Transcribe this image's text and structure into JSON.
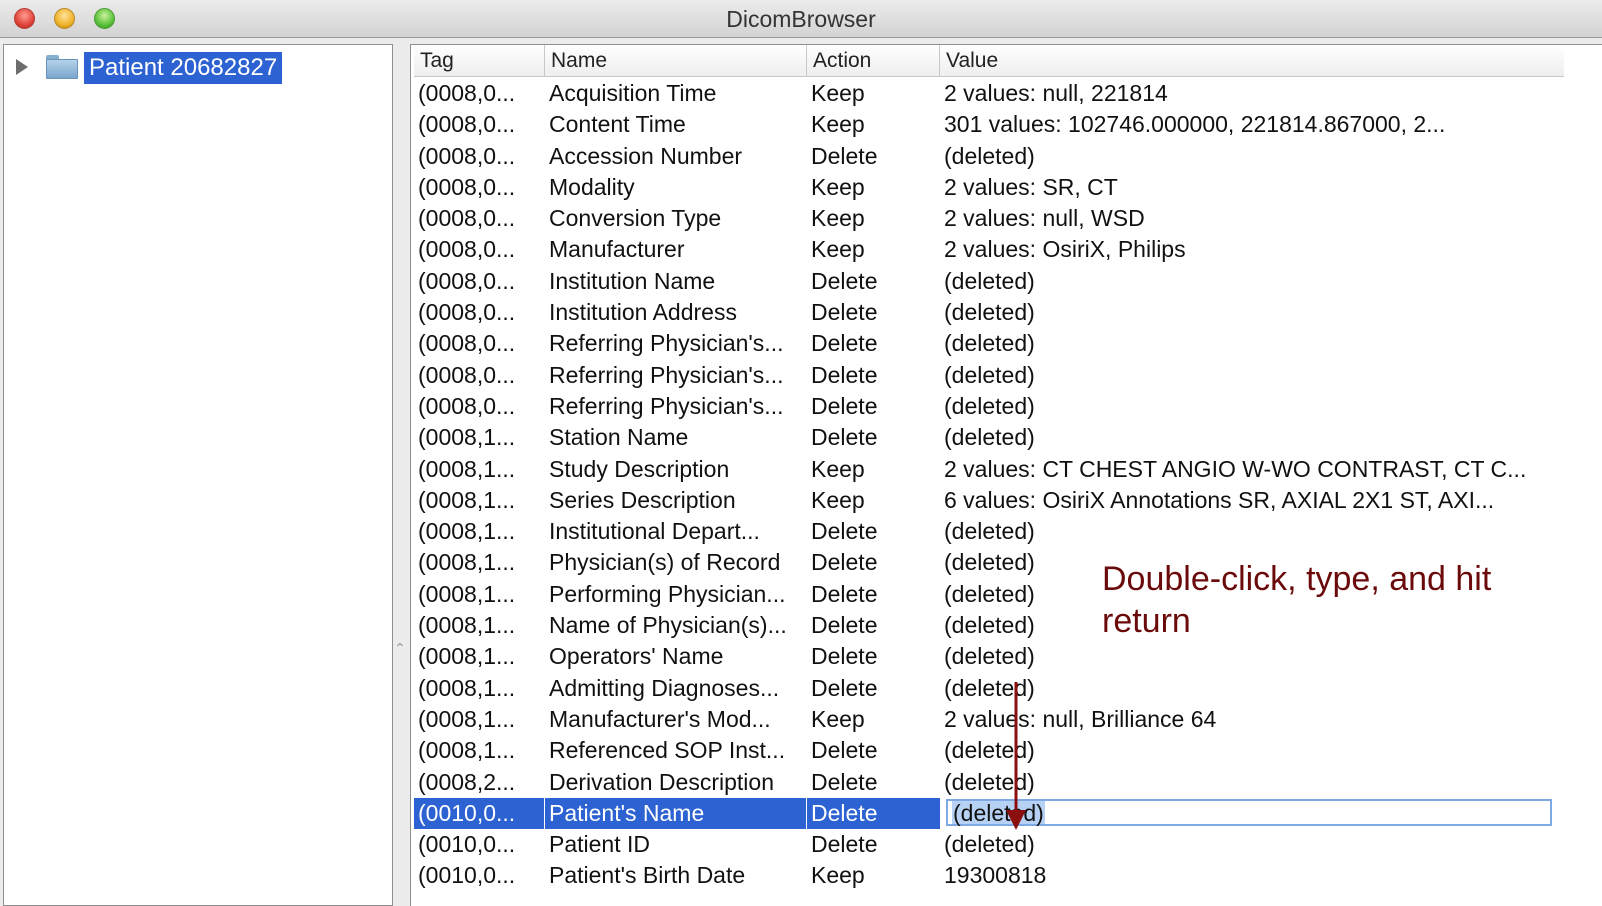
{
  "window": {
    "title": "DicomBrowser"
  },
  "tree": {
    "items": [
      {
        "label": "Patient 20682827",
        "selected": true
      }
    ]
  },
  "table": {
    "columns": [
      "Tag",
      "Name",
      "Action",
      "Value"
    ],
    "rows": [
      {
        "tag": "(0008,0...",
        "name": "Acquisition Time",
        "action": "Keep",
        "value": "2 values: null, 221814"
      },
      {
        "tag": "(0008,0...",
        "name": "Content Time",
        "action": "Keep",
        "value": "301 values: 102746.000000, 221814.867000, 2..."
      },
      {
        "tag": "(0008,0...",
        "name": "Accession Number",
        "action": "Delete",
        "value": "(deleted)"
      },
      {
        "tag": "(0008,0...",
        "name": "Modality",
        "action": "Keep",
        "value": "2 values: SR, CT"
      },
      {
        "tag": "(0008,0...",
        "name": "Conversion Type",
        "action": "Keep",
        "value": "2 values: null, WSD"
      },
      {
        "tag": "(0008,0...",
        "name": "Manufacturer",
        "action": "Keep",
        "value": "2 values: OsiriX, Philips"
      },
      {
        "tag": "(0008,0...",
        "name": "Institution Name",
        "action": "Delete",
        "value": "(deleted)"
      },
      {
        "tag": "(0008,0...",
        "name": "Institution Address",
        "action": "Delete",
        "value": "(deleted)"
      },
      {
        "tag": "(0008,0...",
        "name": "Referring Physician's...",
        "action": "Delete",
        "value": "(deleted)"
      },
      {
        "tag": "(0008,0...",
        "name": "Referring Physician's...",
        "action": "Delete",
        "value": "(deleted)"
      },
      {
        "tag": "(0008,0...",
        "name": "Referring Physician's...",
        "action": "Delete",
        "value": "(deleted)"
      },
      {
        "tag": "(0008,1...",
        "name": "Station Name",
        "action": "Delete",
        "value": "(deleted)"
      },
      {
        "tag": "(0008,1...",
        "name": "Study Description",
        "action": "Keep",
        "value": "2 values: CT CHEST ANGIO W-WO CONTRAST, CT C..."
      },
      {
        "tag": "(0008,1...",
        "name": "Series Description",
        "action": "Keep",
        "value": "6 values: OsiriX Annotations SR, AXIAL 2X1 ST, AXI..."
      },
      {
        "tag": "(0008,1...",
        "name": "Institutional Depart...",
        "action": "Delete",
        "value": "(deleted)"
      },
      {
        "tag": "(0008,1...",
        "name": "Physician(s) of Record",
        "action": "Delete",
        "value": "(deleted)"
      },
      {
        "tag": "(0008,1...",
        "name": "Performing Physician...",
        "action": "Delete",
        "value": "(deleted)"
      },
      {
        "tag": "(0008,1...",
        "name": "Name of Physician(s)...",
        "action": "Delete",
        "value": "(deleted)"
      },
      {
        "tag": "(0008,1...",
        "name": "Operators' Name",
        "action": "Delete",
        "value": "(deleted)"
      },
      {
        "tag": "(0008,1...",
        "name": "Admitting Diagnoses...",
        "action": "Delete",
        "value": "(deleted)"
      },
      {
        "tag": "(0008,1...",
        "name": "Manufacturer's Mod...",
        "action": "Keep",
        "value": "2 values: null, Brilliance 64"
      },
      {
        "tag": "(0008,1...",
        "name": "Referenced SOP Inst...",
        "action": "Delete",
        "value": "(deleted)"
      },
      {
        "tag": "(0008,2...",
        "name": "Derivation Description",
        "action": "Delete",
        "value": "(deleted)"
      },
      {
        "tag": "(0010,0...",
        "name": "Patient's Name",
        "action": "Delete",
        "value": "(deleted)",
        "selected": true,
        "editing": true
      },
      {
        "tag": "(0010,0...",
        "name": "Patient ID",
        "action": "Delete",
        "value": "(deleted)"
      },
      {
        "tag": "(0010,0...",
        "name": "Patient's Birth Date",
        "action": "Keep",
        "value": "19300818"
      }
    ]
  },
  "annotation": {
    "text": "Double-click, type, and hit return",
    "color": "#6b0a0a"
  },
  "colors": {
    "selection": "#2c62d1",
    "edit_highlight": "#b7d1f5"
  }
}
